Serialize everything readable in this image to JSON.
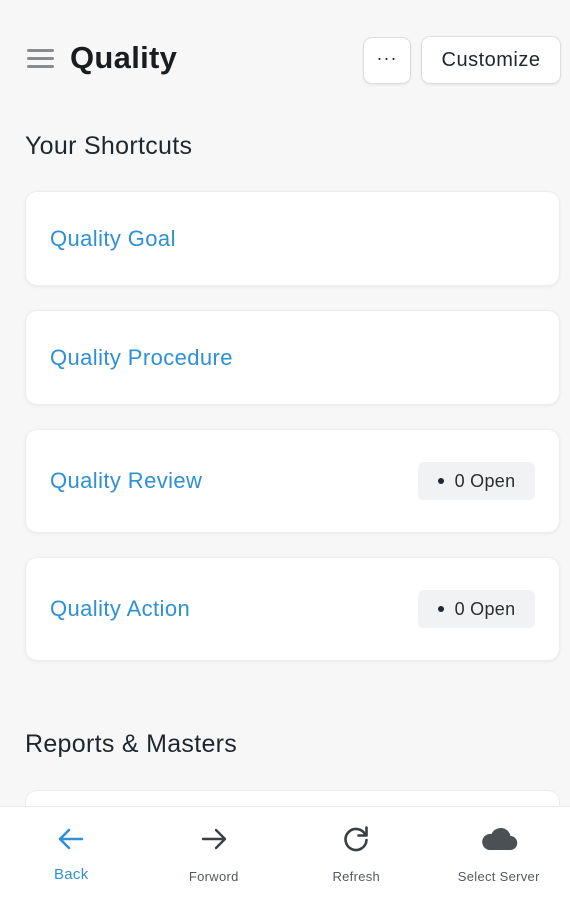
{
  "header": {
    "title": "Quality",
    "more_label": "···",
    "customize_label": "Customize"
  },
  "shortcuts": {
    "title": "Your Shortcuts",
    "items": [
      {
        "label": "Quality Goal"
      },
      {
        "label": "Quality Procedure"
      },
      {
        "label": "Quality Review",
        "badge": "0 Open"
      },
      {
        "label": "Quality Action",
        "badge": "0 Open"
      }
    ]
  },
  "reports": {
    "title": "Reports & Masters"
  },
  "bottom_nav": {
    "items": [
      {
        "label": "Back",
        "icon": "arrow-left-icon",
        "active": true
      },
      {
        "label": "Forword",
        "icon": "arrow-right-icon"
      },
      {
        "label": "Refresh",
        "icon": "refresh-icon"
      },
      {
        "label": "Select Server",
        "icon": "cloud-icon"
      }
    ]
  },
  "colors": {
    "link": "#2e90d6",
    "background": "#f7f7f8",
    "card": "#ffffff"
  }
}
